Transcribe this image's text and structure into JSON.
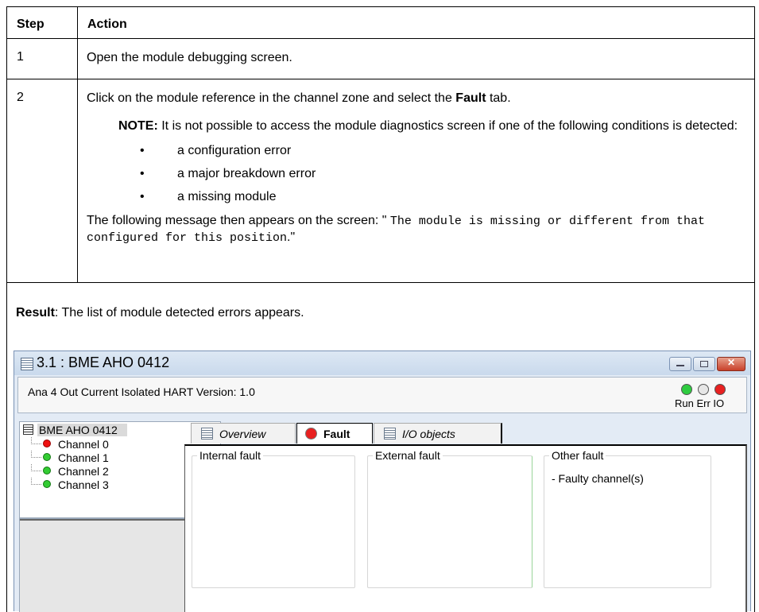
{
  "table": {
    "header_step": "Step",
    "header_action": "Action",
    "step1": {
      "num": "1",
      "text": "Open the module debugging screen."
    },
    "step2": {
      "num": "2",
      "text_before": "Click on the module reference in the channel zone and select the ",
      "text_bold": "Fault",
      "text_after": " tab.",
      "note_label": "NOTE:",
      "note_text": " It is not possible to access the module diagnostics screen if one of the following conditions is detected:",
      "bullet_char": "•",
      "bullets": [
        "a configuration error",
        "a major breakdown error",
        "a missing module"
      ],
      "message_intro": "The following message then appears on the screen: \" ",
      "message_code": "The module is missing or different from that configured for this position",
      "message_end": ".\""
    },
    "result": {
      "label": "Result",
      "text": ": The list of module detected errors appears."
    }
  },
  "window": {
    "title": "3.1 : BME AHO 0412",
    "info": "Ana 4 Out Current Isolated HART Version: 1.0",
    "led_labels": "Run Err IO",
    "tree": {
      "root": "BME AHO 0412",
      "channels": [
        {
          "label": "Channel 0",
          "status": "red"
        },
        {
          "label": "Channel 1",
          "status": "green"
        },
        {
          "label": "Channel 2",
          "status": "green"
        },
        {
          "label": "Channel 3",
          "status": "green"
        }
      ]
    },
    "tabs": {
      "overview": "Overview",
      "fault": "Fault",
      "io": "I/O objects"
    },
    "groups": {
      "internal": "Internal fault",
      "external": "External fault",
      "other": "Other fault",
      "other_item": "- Faulty channel(s)"
    }
  }
}
